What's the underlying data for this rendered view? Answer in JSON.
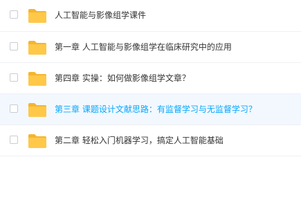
{
  "file_list": {
    "items": [
      {
        "name": "人工智能与影像组学课件",
        "icon": "folder-icon",
        "hovered": false
      },
      {
        "name": "第一章 人工智能与影像组学在临床研究中的应用",
        "icon": "folder-icon",
        "hovered": false
      },
      {
        "name": "第四章 实操：如何做影像组学文章？",
        "icon": "folder-icon",
        "hovered": false
      },
      {
        "name": "第三章 课题设计文献思路：有监督学习与无监督学习？",
        "icon": "folder-icon",
        "hovered": true
      },
      {
        "name": "第二章 轻松入门机器学习，搞定人工智能基础",
        "icon": "folder-icon",
        "hovered": false
      }
    ]
  },
  "colors": {
    "folder": "#ffc849",
    "folder_tab": "#f5b52e",
    "hover_background": "#f2f8fe",
    "hover_text": "#06a7ff",
    "text": "#333333"
  }
}
